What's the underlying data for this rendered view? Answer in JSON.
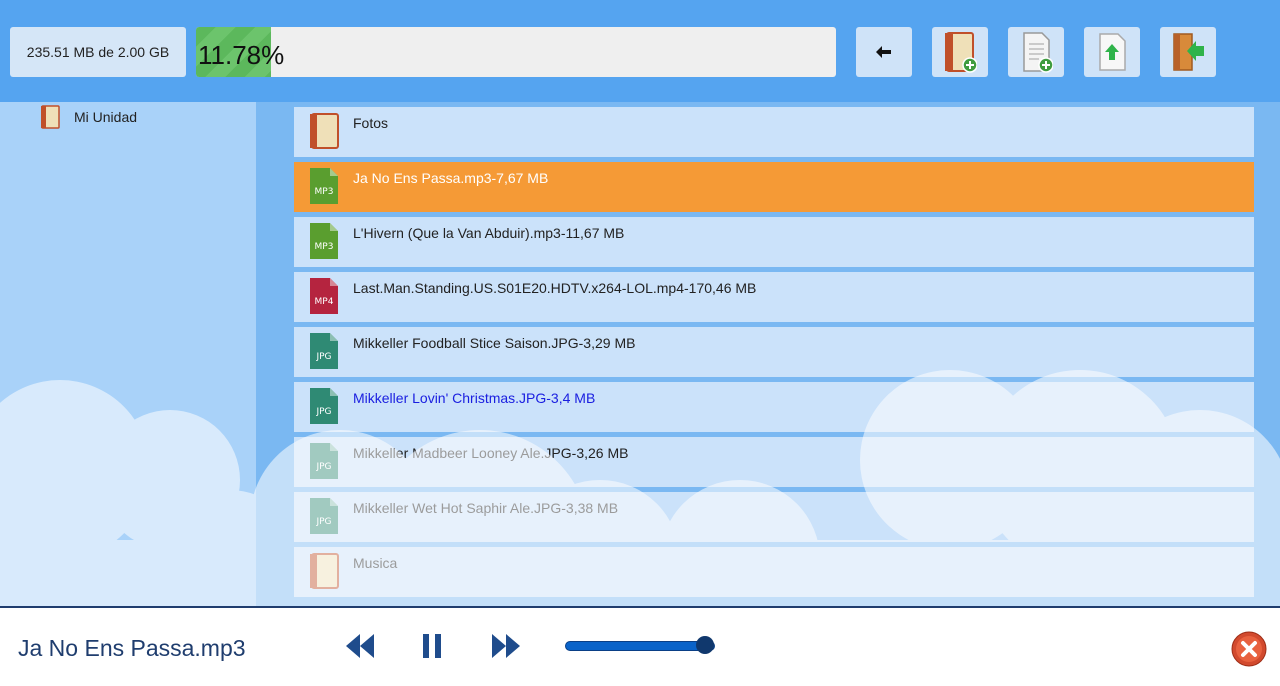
{
  "topbar": {
    "usage_text": "235.51 MB de 2.00 GB",
    "progress_fraction": 0.1178,
    "progress_label": "11.78%",
    "buttons": [
      {
        "name": "back-button",
        "icon": "arrow-left-icon"
      },
      {
        "name": "new-folder-button",
        "icon": "folder-add-icon"
      },
      {
        "name": "new-file-button",
        "icon": "document-add-icon"
      },
      {
        "name": "upload-button",
        "icon": "upload-icon"
      },
      {
        "name": "logout-button",
        "icon": "exit-door-icon"
      }
    ]
  },
  "sidebar": {
    "items": [
      {
        "label": "Mi Unidad",
        "icon": "folder-icon"
      }
    ]
  },
  "files": [
    {
      "label": "Fotos",
      "icon": "folder",
      "state": "normal"
    },
    {
      "label": "Ja No Ens Passa.mp3-7,67 MB",
      "icon": "MP3",
      "state": "selected"
    },
    {
      "label": "L'Hivern (Que la Van Abduir).mp3-11,67 MB",
      "icon": "MP3",
      "state": "normal"
    },
    {
      "label": "Last.Man.Standing.US.S01E20.HDTV.x264-LOL.mp4-170,46 MB",
      "icon": "MP4",
      "state": "normal"
    },
    {
      "label": "Mikkeller Foodball Stice Saison.JPG-3,29 MB",
      "icon": "JPG",
      "state": "normal"
    },
    {
      "label": "Mikkeller Lovin' Christmas.JPG-3,4 MB",
      "icon": "JPG",
      "state": "hover"
    },
    {
      "label": "Mikkeller Madbeer Looney Ale.JPG-3,26 MB",
      "icon": "JPG",
      "state": "normal"
    },
    {
      "label": "Mikkeller Wet Hot Saphir Ale.JPG-3,38 MB",
      "icon": "JPG",
      "state": "normal"
    },
    {
      "label": "Musica",
      "icon": "folder",
      "state": "normal"
    }
  ],
  "player": {
    "track_title": "Ja No Ens Passa.mp3",
    "volume_fraction": 0.93,
    "controls": [
      "rewind-icon",
      "pause-icon",
      "fast-forward-icon"
    ],
    "close_icon": "close-icon"
  },
  "colors": {
    "topbar": "#55a4f0",
    "selected_row": "#f59a36",
    "hover_text": "#1a1ee0",
    "player_text": "#1f3d6e",
    "mp3_icon": "#5a9e2f",
    "mp4_icon": "#b5243f",
    "jpg_icon": "#2f8a74"
  }
}
